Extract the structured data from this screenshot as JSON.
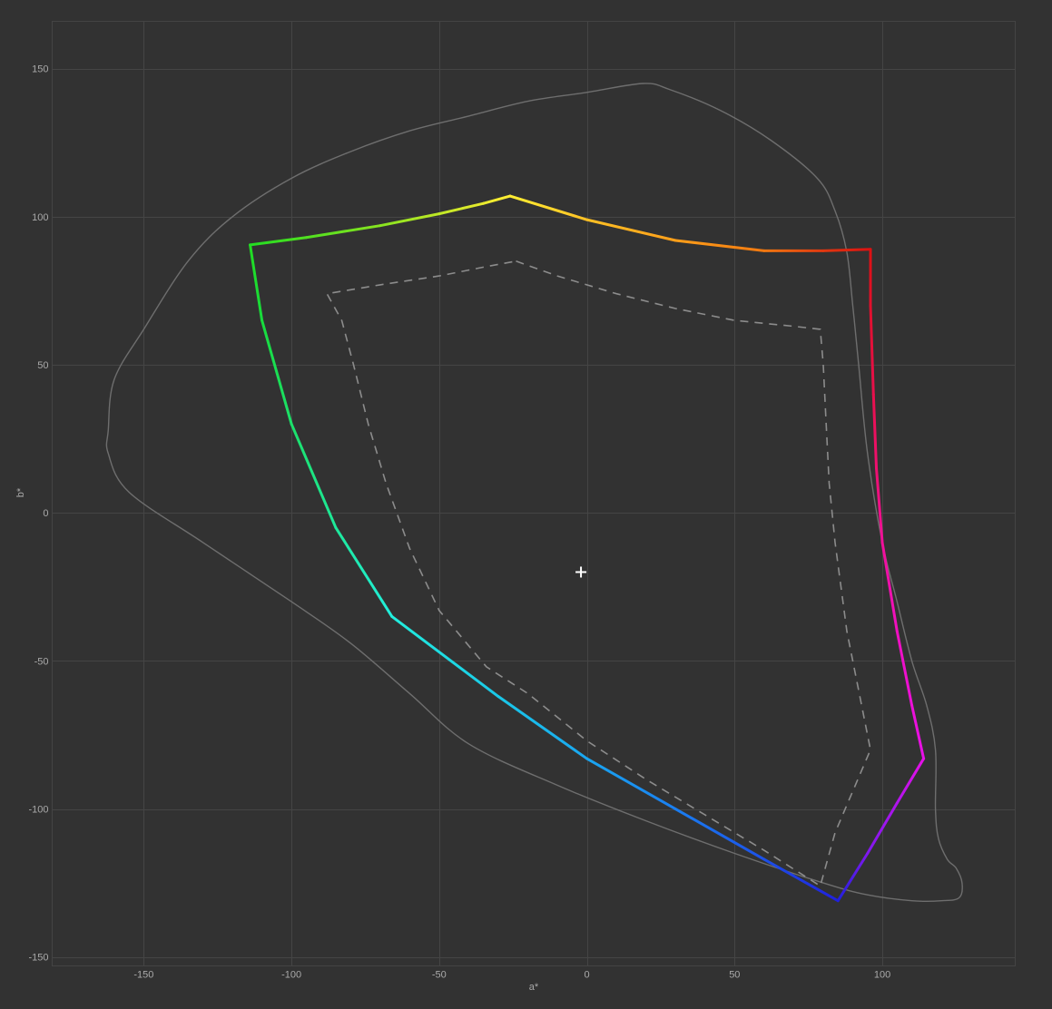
{
  "chart_data": {
    "type": "line",
    "title": "",
    "xlabel": "a*",
    "ylabel": "b*",
    "xlim": [
      -181,
      145
    ],
    "ylim": [
      -153,
      166
    ],
    "grid": true,
    "x_ticks": [
      -150,
      -100,
      -50,
      0,
      50,
      100
    ],
    "y_ticks": [
      150,
      100,
      50,
      0,
      -50,
      -100,
      -150
    ],
    "white_point": {
      "a": -2,
      "b": -20,
      "marker": "plus",
      "color": "#ffffff"
    },
    "series": [
      {
        "style": "solid-gray",
        "color": "#6e6e6e",
        "closed": true,
        "points": [
          [
            19,
            145
          ],
          [
            28,
            143
          ],
          [
            45,
            136
          ],
          [
            62,
            126
          ],
          [
            78,
            113
          ],
          [
            84,
            102
          ],
          [
            88,
            88
          ],
          [
            90,
            70
          ],
          [
            92,
            50
          ],
          [
            95,
            20
          ],
          [
            100,
            -10
          ],
          [
            105,
            -30
          ],
          [
            110,
            -50
          ],
          [
            115,
            -65
          ],
          [
            118,
            -80
          ],
          [
            118,
            -100
          ],
          [
            119,
            -110
          ],
          [
            122,
            -117
          ],
          [
            125,
            -120
          ],
          [
            127,
            -125
          ],
          [
            126,
            -130
          ],
          [
            120,
            -131
          ],
          [
            110,
            -131
          ],
          [
            95,
            -129
          ],
          [
            80,
            -125
          ],
          [
            50,
            -115
          ],
          [
            20,
            -104
          ],
          [
            -10,
            -92
          ],
          [
            -40,
            -78
          ],
          [
            -60,
            -61
          ],
          [
            -80,
            -44
          ],
          [
            -100,
            -30
          ],
          [
            -130,
            -10
          ],
          [
            -155,
            7
          ],
          [
            -162,
            20
          ],
          [
            -162,
            28
          ],
          [
            -160,
            45
          ],
          [
            -150,
            62
          ],
          [
            -135,
            85
          ],
          [
            -120,
            100
          ],
          [
            -100,
            113
          ],
          [
            -80,
            122
          ],
          [
            -60,
            129
          ],
          [
            -40,
            134
          ],
          [
            -20,
            139
          ],
          [
            0,
            142
          ]
        ]
      },
      {
        "style": "dashed",
        "color": "#8c8c8c",
        "closed": true,
        "points": [
          [
            -24,
            85
          ],
          [
            -10,
            80
          ],
          [
            10,
            74
          ],
          [
            30,
            69
          ],
          [
            50,
            65
          ],
          [
            70,
            63
          ],
          [
            79,
            62
          ],
          [
            80,
            50
          ],
          [
            81,
            30
          ],
          [
            82,
            10
          ],
          [
            84,
            -10
          ],
          [
            88,
            -40
          ],
          [
            92,
            -60
          ],
          [
            96,
            -80
          ],
          [
            90,
            -94
          ],
          [
            84,
            -108
          ],
          [
            79,
            -126
          ],
          [
            60,
            -114
          ],
          [
            40,
            -102
          ],
          [
            20,
            -90
          ],
          [
            0,
            -77
          ],
          [
            -20,
            -61
          ],
          [
            -34,
            -52
          ],
          [
            -50,
            -33
          ],
          [
            -60,
            -12
          ],
          [
            -68,
            10
          ],
          [
            -74,
            30
          ],
          [
            -79,
            50
          ],
          [
            -83,
            65
          ],
          [
            -88,
            74
          ],
          [
            -70,
            77
          ],
          [
            -50,
            80
          ],
          [
            -35,
            83
          ]
        ]
      },
      {
        "style": "gradient",
        "closed": true,
        "points": [
          {
            "a": -26,
            "b": 107,
            "color": "#ffee33"
          },
          {
            "a": 0,
            "b": 99,
            "color": "#ffc125"
          },
          {
            "a": 30,
            "b": 92,
            "color": "#ff9f1a"
          },
          {
            "a": 60,
            "b": 88.5,
            "color": "#f07810"
          },
          {
            "a": 80,
            "b": 88.5,
            "color": "#e03810"
          },
          {
            "a": 96,
            "b": 89,
            "color": "#dd1111"
          },
          {
            "a": 96,
            "b": 70,
            "color": "#e0102c"
          },
          {
            "a": 97,
            "b": 40,
            "color": "#e8104c"
          },
          {
            "a": 98,
            "b": 15,
            "color": "#ee1070"
          },
          {
            "a": 100,
            "b": -10,
            "color": "#f0109a"
          },
          {
            "a": 105,
            "b": -40,
            "color": "#f010c0"
          },
          {
            "a": 110,
            "b": -65,
            "color": "#ec10d8"
          },
          {
            "a": 114,
            "b": -83,
            "color": "#e810e8"
          },
          {
            "a": 105,
            "b": -98,
            "color": "#b014ec"
          },
          {
            "a": 95,
            "b": -115,
            "color": "#8018ee"
          },
          {
            "a": 85,
            "b": -131,
            "color": "#2020dd"
          },
          {
            "a": 60,
            "b": -117,
            "color": "#1c50e8"
          },
          {
            "a": 30,
            "b": -100,
            "color": "#1a7ef0"
          },
          {
            "a": 0,
            "b": -83,
            "color": "#1aa6f0"
          },
          {
            "a": -30,
            "b": -62,
            "color": "#1ac8e8"
          },
          {
            "a": -66,
            "b": -35,
            "color": "#22eedd"
          },
          {
            "a": -85,
            "b": -5,
            "color": "#1ee89a"
          },
          {
            "a": -100,
            "b": 30,
            "color": "#1ce06a"
          },
          {
            "a": -110,
            "b": 65,
            "color": "#18dc3c"
          },
          {
            "a": -114,
            "b": 90.5,
            "color": "#22dd22"
          },
          {
            "a": -95,
            "b": 93,
            "color": "#50e020"
          },
          {
            "a": -70,
            "b": 97,
            "color": "#88e420"
          },
          {
            "a": -50,
            "b": 101,
            "color": "#c0e826"
          },
          {
            "a": -35,
            "b": 104.5,
            "color": "#e8ea2e"
          }
        ]
      }
    ]
  }
}
